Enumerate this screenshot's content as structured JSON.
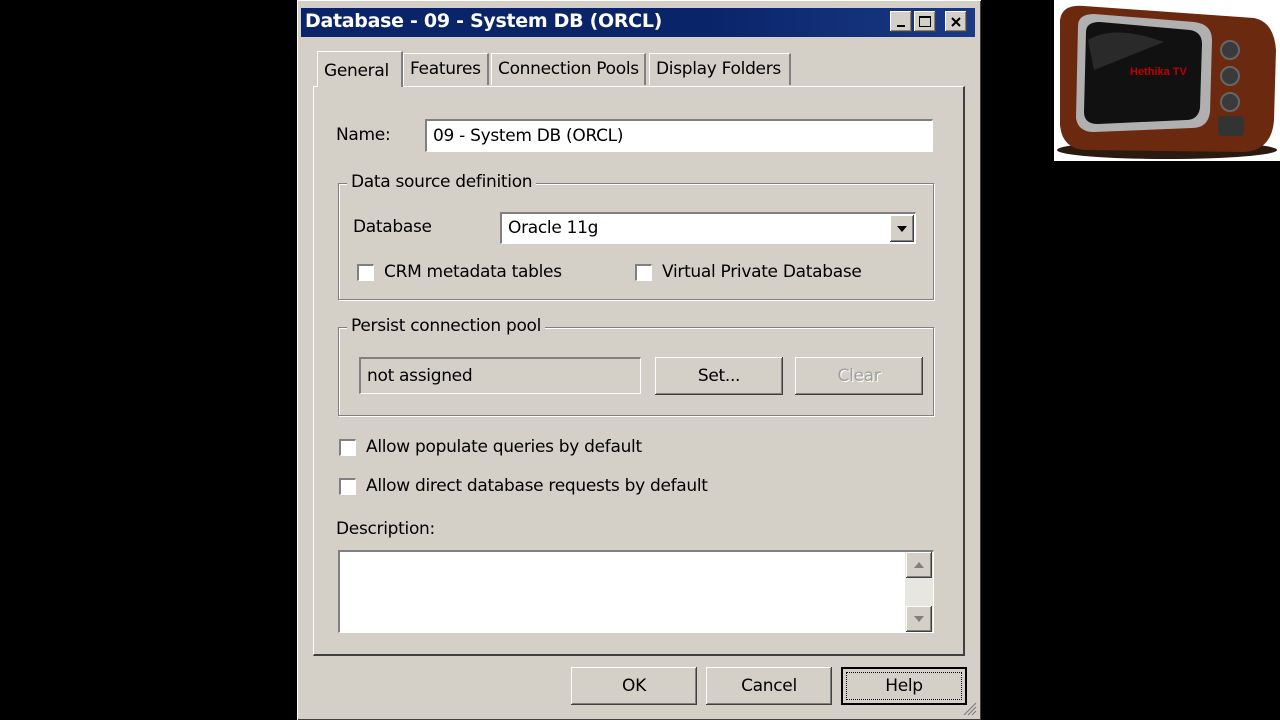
{
  "window": {
    "title": "Database - 09 - System DB (ORCL)",
    "controls": [
      "minimize-icon",
      "maximize-icon",
      "close-icon"
    ]
  },
  "tabs": [
    {
      "label": "General",
      "active": true
    },
    {
      "label": "Features",
      "active": false
    },
    {
      "label": "Connection Pools",
      "active": false
    },
    {
      "label": "Display Folders",
      "active": false
    }
  ],
  "general": {
    "name_label": "Name:",
    "name_value": "09 - System DB (ORCL)",
    "data_source": {
      "legend": "Data source definition",
      "database_label": "Database",
      "database_value": "Oracle 11g",
      "crm_label": "CRM metadata tables",
      "crm_checked": false,
      "vpd_label": "Virtual Private Database",
      "vpd_checked": false
    },
    "persist_pool": {
      "legend": "Persist connection pool",
      "value": "not assigned",
      "set_label": "Set...",
      "clear_label": "Clear"
    },
    "allow_populate_label": "Allow populate queries by default",
    "allow_populate_checked": false,
    "allow_direct_label": "Allow direct database requests by default",
    "allow_direct_checked": false,
    "description_label": "Description:",
    "description_value": ""
  },
  "buttons": {
    "ok": "OK",
    "cancel": "Cancel",
    "help": "Help"
  },
  "overlay": {
    "logo_text": "Hethika TV"
  },
  "colors": {
    "titlebar": "#0a246a",
    "dialog_bg": "#d4d0c8",
    "background": "#000000"
  }
}
